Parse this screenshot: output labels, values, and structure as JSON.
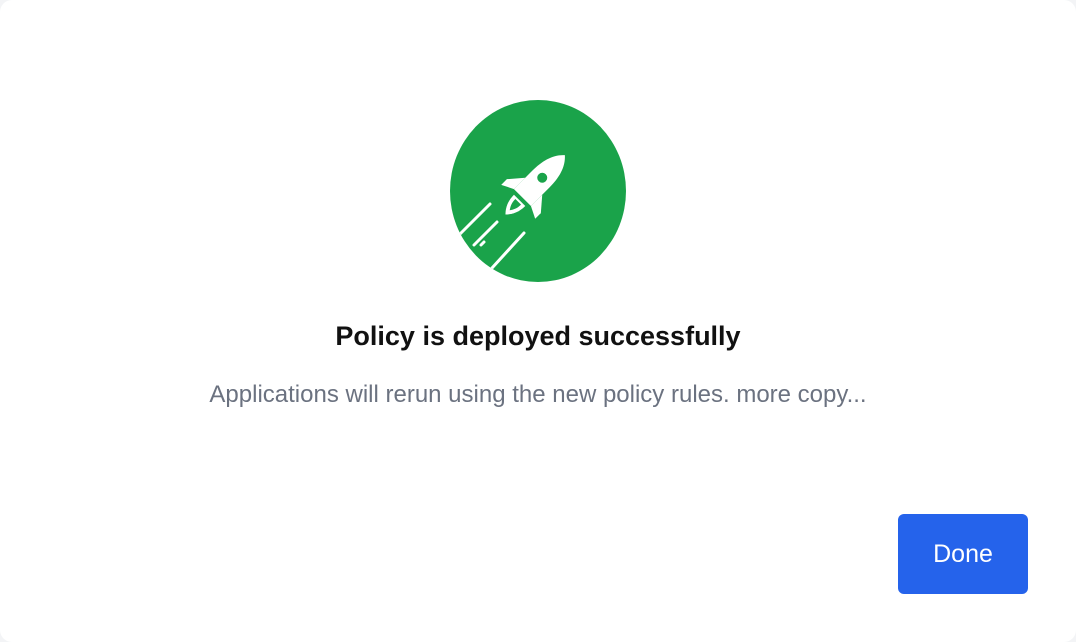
{
  "dialog": {
    "icon": "rocket-icon",
    "icon_background_color": "#1aa34a",
    "title": "Policy is deployed successfully",
    "message": "Applications will rerun using the new policy rules. more copy...",
    "done_label": "Done",
    "button_color": "#2563eb"
  }
}
